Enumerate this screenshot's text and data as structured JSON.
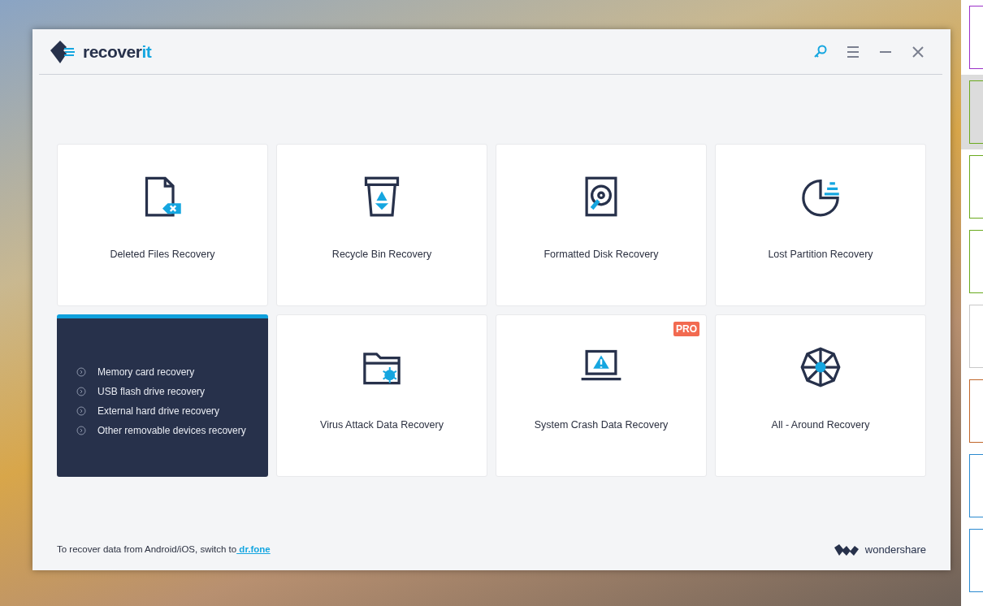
{
  "app": {
    "logo_main": "recover",
    "logo_accent": "it"
  },
  "toolbar": [
    {
      "kind": "key"
    },
    {
      "kind": "menu"
    },
    {
      "kind": "minimize"
    },
    {
      "kind": "close"
    }
  ],
  "cards": [
    {
      "kind": "tile",
      "label": "Deleted Files Recovery",
      "pro": false
    },
    {
      "kind": "tile",
      "label": "Recycle Bin Recovery",
      "pro": false
    },
    {
      "kind": "tile",
      "label": "Formatted Disk Recovery",
      "pro": false
    },
    {
      "kind": "tile",
      "label": "Lost Partition Recovery",
      "pro": false
    },
    {
      "kind": "list",
      "items": [
        "Memory card recovery",
        "USB flash drive recovery",
        "External hard drive recovery",
        "Other removable devices recovery"
      ]
    },
    {
      "kind": "tile",
      "label": "Virus Attack Data Recovery",
      "pro": false
    },
    {
      "kind": "tile",
      "label": "System Crash Data Recovery",
      "pro": true,
      "badge": "PRO"
    },
    {
      "kind": "tile",
      "label": "All - Around Recovery",
      "pro": false
    }
  ],
  "footer": {
    "text": "To recover data from Android/iOS, switch to",
    "link": " dr.fone",
    "brand": "wondershare"
  },
  "side_strip": [
    {
      "color": "#9b30c8",
      "selected": false
    },
    {
      "color": "#6aaa1e",
      "selected": true
    },
    {
      "color": "#6aaa1e",
      "selected": false
    },
    {
      "color": "#6aaa1e",
      "selected": false
    },
    {
      "color": "#c8c8c8",
      "selected": false
    },
    {
      "color": "#c0662a",
      "selected": false
    },
    {
      "color": "#2a8ad0",
      "selected": false
    },
    {
      "color": "#2a8ad0",
      "selected": false
    }
  ]
}
